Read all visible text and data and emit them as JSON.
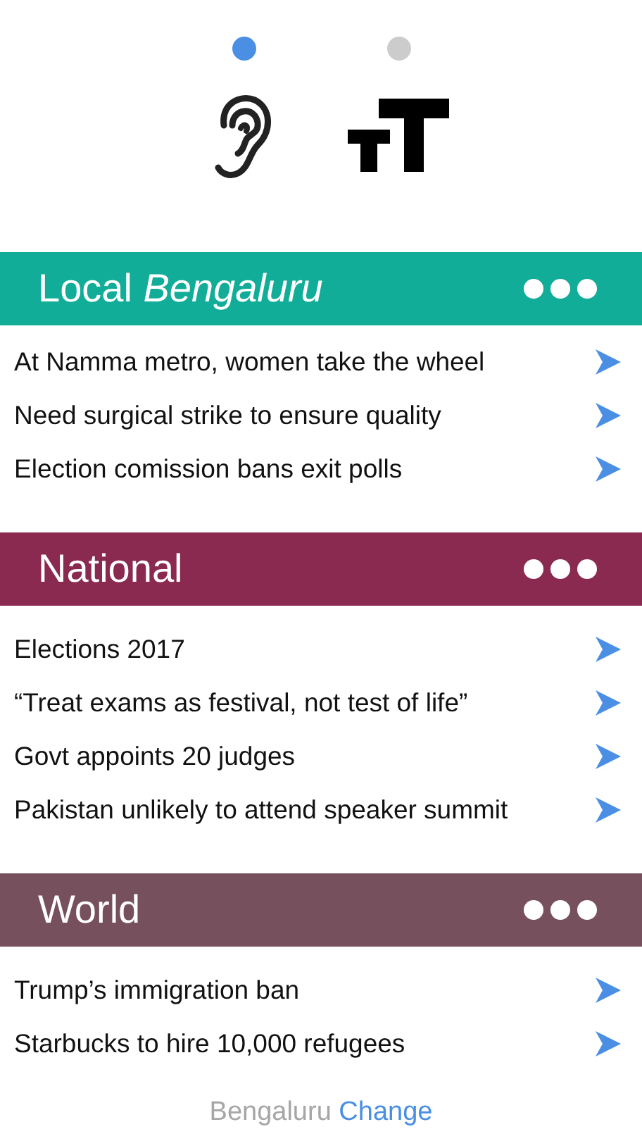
{
  "modes": [
    {
      "kind": "listen",
      "selected": true
    },
    {
      "kind": "text-size",
      "selected": false
    }
  ],
  "sections": [
    {
      "title": "Local *Bengaluru*",
      "color": "#11ad98",
      "items": [
        "At Namma metro, women take the wheel",
        "Need surgical strike to ensure quality",
        "Election comission bans exit polls"
      ]
    },
    {
      "title": "National",
      "color": "#8a2a50",
      "items": [
        "Elections 2017",
        "“Treat exams as festival, not test of life”",
        "Govt appoints 20 judges",
        "Pakistan unlikely to attend speaker summit"
      ]
    },
    {
      "title": "World",
      "color": "#76505c",
      "items": [
        "Trump’s immigration ban",
        "Starbucks to hire 10,000 refugees"
      ]
    }
  ],
  "footer": {
    "city": "Bengaluru",
    "action": "Change"
  }
}
